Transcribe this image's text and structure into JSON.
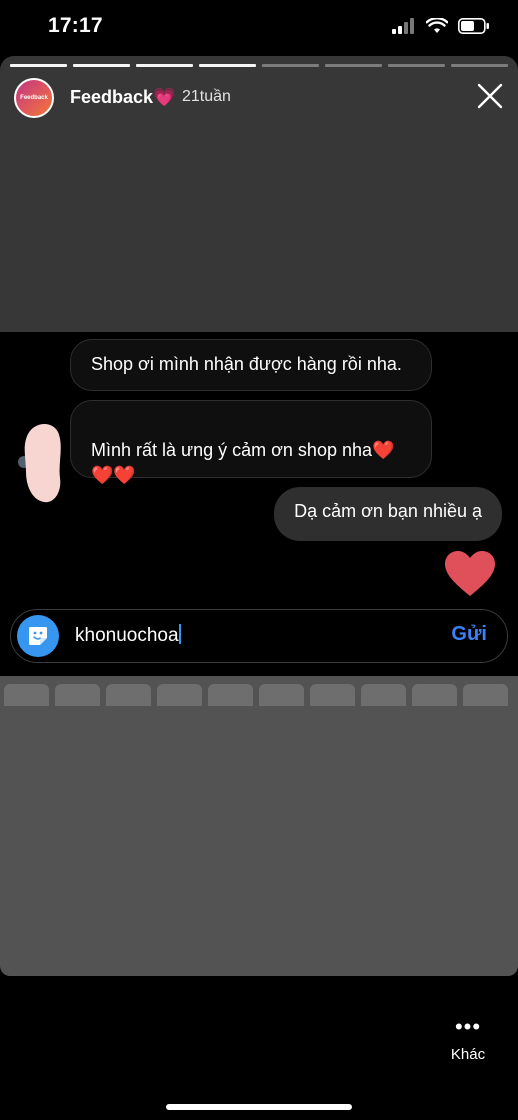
{
  "status": {
    "time": "17:17"
  },
  "story": {
    "progress_total": 8,
    "progress_done": 4,
    "user_name": "Feedback💗",
    "avatar_text": "Feedback",
    "time_ago": "21tuần"
  },
  "messages": [
    {
      "text": "Shop ơi mình nhận được hàng rồi nha."
    },
    {
      "text": "Mình rất là ưng ý cảm ơn shop nha❤️\n❤️❤️"
    }
  ],
  "my_message": {
    "text": "Dạ cảm ơn bạn nhiều ạ"
  },
  "reply": {
    "value": "khonuochoa",
    "send_label": "Gửi"
  },
  "footer": {
    "more_label": "Khác"
  },
  "colors": {
    "accent": "#3797f0",
    "heart": "#e0505a"
  }
}
